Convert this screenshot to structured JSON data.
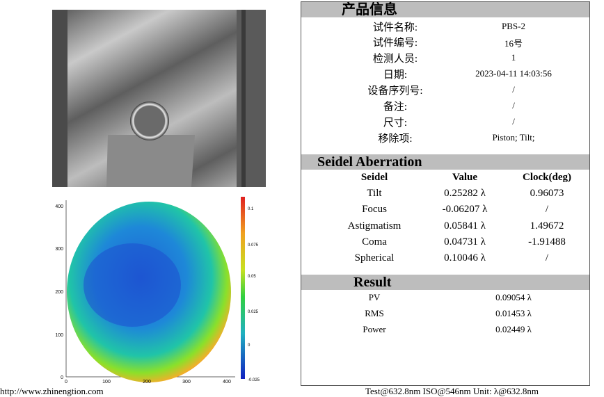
{
  "product_info": {
    "title": "产品信息",
    "rows": [
      {
        "label": "试件名称:",
        "value": "PBS-2"
      },
      {
        "label": "试件编号:",
        "value": "16号"
      },
      {
        "label": "检测人员:",
        "value": "1"
      },
      {
        "label": "日期:",
        "value": "2023-04-11 14:03:56"
      },
      {
        "label": "设备序列号:",
        "value": "/"
      },
      {
        "label": "备注:",
        "value": "/"
      },
      {
        "label": "尺寸:",
        "value": "/"
      },
      {
        "label": "移除项:",
        "value": "Piston; Tilt;"
      }
    ]
  },
  "seidel": {
    "title": "Seidel Aberration",
    "headers": [
      "Seidel",
      "Value",
      "Clock(deg)"
    ],
    "rows": [
      {
        "name": "Tilt",
        "value": "0.25282 λ",
        "clock": "0.96073"
      },
      {
        "name": "Focus",
        "value": "-0.06207 λ",
        "clock": "/"
      },
      {
        "name": "Astigmatism",
        "value": "0.05841 λ",
        "clock": "1.49672"
      },
      {
        "name": "Coma",
        "value": "0.04731 λ",
        "clock": "-1.91488"
      },
      {
        "name": "Spherical",
        "value": "0.10046 λ",
        "clock": "/"
      }
    ]
  },
  "result": {
    "title": "Result",
    "rows": [
      {
        "name": "PV",
        "value": "0.09054 λ"
      },
      {
        "name": "RMS",
        "value": "0.01453 λ"
      },
      {
        "name": "Power",
        "value": "0.02449 λ"
      }
    ]
  },
  "map": {
    "x_ticks": [
      "0",
      "100",
      "200",
      "300",
      "400"
    ],
    "y_ticks": [
      "400",
      "300",
      "200",
      "100",
      "0"
    ],
    "colorbar_ticks": [
      "0.1",
      "0.075",
      "0.05",
      "0.025",
      "0",
      "-0.025"
    ]
  },
  "footer": {
    "left": "http://www.zhinengtion.com",
    "right": "Test@632.8nm   ISO@546nm   Unit: λ@632.8nm"
  }
}
